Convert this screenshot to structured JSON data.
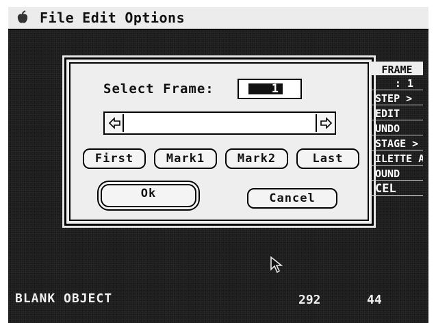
{
  "menubar": {
    "items": [
      "File",
      "Edit",
      "Options"
    ]
  },
  "dialog": {
    "select_label": "Select Frame:",
    "frame_value": "1",
    "buttons": {
      "first": "First",
      "mark1": "Mark1",
      "mark2": "Mark2",
      "last": "Last",
      "ok": "Ok",
      "cancel": "Cancel"
    }
  },
  "side_panel": {
    "items": [
      "FRAME",
      ":  1",
      "STEP >",
      "EDIT",
      "UNDO",
      "STAGE >",
      "ILETTE A",
      "OUND",
      "CEL"
    ]
  },
  "status": {
    "label": "BLANK OBJECT",
    "x": "292",
    "y": "44"
  },
  "colors": {
    "screen_bg": "#1d1d1d",
    "menubar_bg": "#ececec",
    "dialog_bg": "#eeeeee",
    "text_light": "#f0f0f0"
  },
  "icons": [
    "apple-icon",
    "left-arrow-icon",
    "right-arrow-icon",
    "mouse-pointer-icon"
  ]
}
